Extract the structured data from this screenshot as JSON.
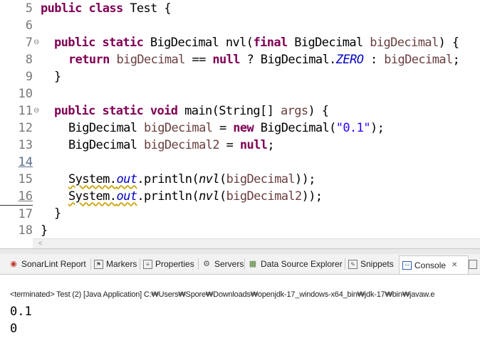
{
  "editor": {
    "line_numbers": [
      "5",
      "6",
      "7",
      "8",
      "9",
      "10",
      "11",
      "12",
      "13",
      "14",
      "15",
      "16",
      "17",
      "18"
    ],
    "fold_markers": [
      "⊖",
      "⊖"
    ],
    "lines": {
      "l5": {
        "kw1": "public class",
        "rest": " Test {"
      },
      "l7": {
        "kw1": "public static",
        "t1": " BigDecimal nvl(",
        "kw2": "final",
        "t2": " BigDecimal ",
        "v1": "bigDecimal",
        "t3": ") {"
      },
      "l8": {
        "kw1": "return",
        "t1": " ",
        "v1": "bigDecimal",
        "t2": " == ",
        "kw2": "null",
        "t3": " ? BigDecimal.",
        "f1": "ZERO",
        "t4": " : ",
        "v2": "bigDecimal",
        "t5": ";"
      },
      "l9": {
        "t1": "}"
      },
      "l11": {
        "kw1": "public static void",
        "t1": " main(String[] ",
        "v1": "args",
        "t2": ") {"
      },
      "l12": {
        "t1": "BigDecimal ",
        "v1": "bigDecimal",
        "t2": " = ",
        "kw1": "new",
        "t3": " BigDecimal(",
        "s1": "\"0.1\"",
        "t4": ");"
      },
      "l13": {
        "t1": "BigDecimal ",
        "v1": "bigDecimal2",
        "t2": " = ",
        "kw1": "null",
        "t3": ";"
      },
      "l15": {
        "t1": "System.",
        "f1": "out",
        "t2": ".println(",
        "m1": "nvl",
        "t3": "(",
        "v1": "bigDecimal",
        "t4": "));"
      },
      "l16": {
        "t1": "System.",
        "f1": "out",
        "t2": ".println(",
        "m1": "nvl",
        "t3": "(",
        "v1": "bigDecimal2",
        "t4": "));"
      },
      "l17": {
        "t1": "}"
      },
      "l18": {
        "t1": "}"
      }
    }
  },
  "scroll": {
    "left_arrow": "<"
  },
  "tabs": [
    {
      "label": "SonarLint Report",
      "icon": "sonarlint-icon"
    },
    {
      "label": "Markers",
      "icon": "markers-icon"
    },
    {
      "label": "Properties",
      "icon": "properties-icon"
    },
    {
      "label": "Servers",
      "icon": "servers-icon"
    },
    {
      "label": "Data Source Explorer",
      "icon": "data-source-icon"
    },
    {
      "label": "Snippets",
      "icon": "snippets-icon"
    },
    {
      "label": "Console",
      "icon": "console-icon",
      "close": "✕"
    }
  ],
  "console": {
    "terminated": "<terminated> Test (2) [Java Application] C:₩Users₩Spore₩Downloads₩openjdk-17_windows-x64_bin₩jdk-17₩bin₩javaw.e",
    "output": [
      "0.1",
      "0"
    ]
  },
  "colors": {
    "keyword": "#7f0055",
    "variable": "#6a3e3e",
    "field": "#0000c0",
    "string": "#2a00ff"
  }
}
